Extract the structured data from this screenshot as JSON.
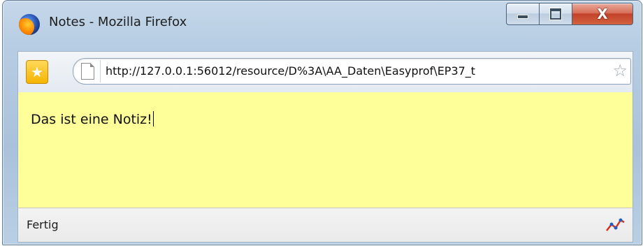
{
  "window": {
    "title": "Notes - Mozilla Firefox",
    "app_icon": "firefox-icon"
  },
  "caption_buttons": {
    "minimize_icon": "minimize-icon",
    "maximize_icon": "maximize-icon",
    "close_glyph": "X"
  },
  "navbar": {
    "bookmark_icon": "star-bookmark-icon",
    "url": "http://127.0.0.1:56012/resource/D%3A\\AA_Daten\\Easyprof\\EP37_t",
    "url_page_icon": "page-icon",
    "url_star_icon": "star-outline-icon"
  },
  "content": {
    "note_text": "Das ist eine Notiz!",
    "background": "#ffff99"
  },
  "statusbar": {
    "text": "Fertig",
    "icon": "chart-sparkline-icon"
  }
}
